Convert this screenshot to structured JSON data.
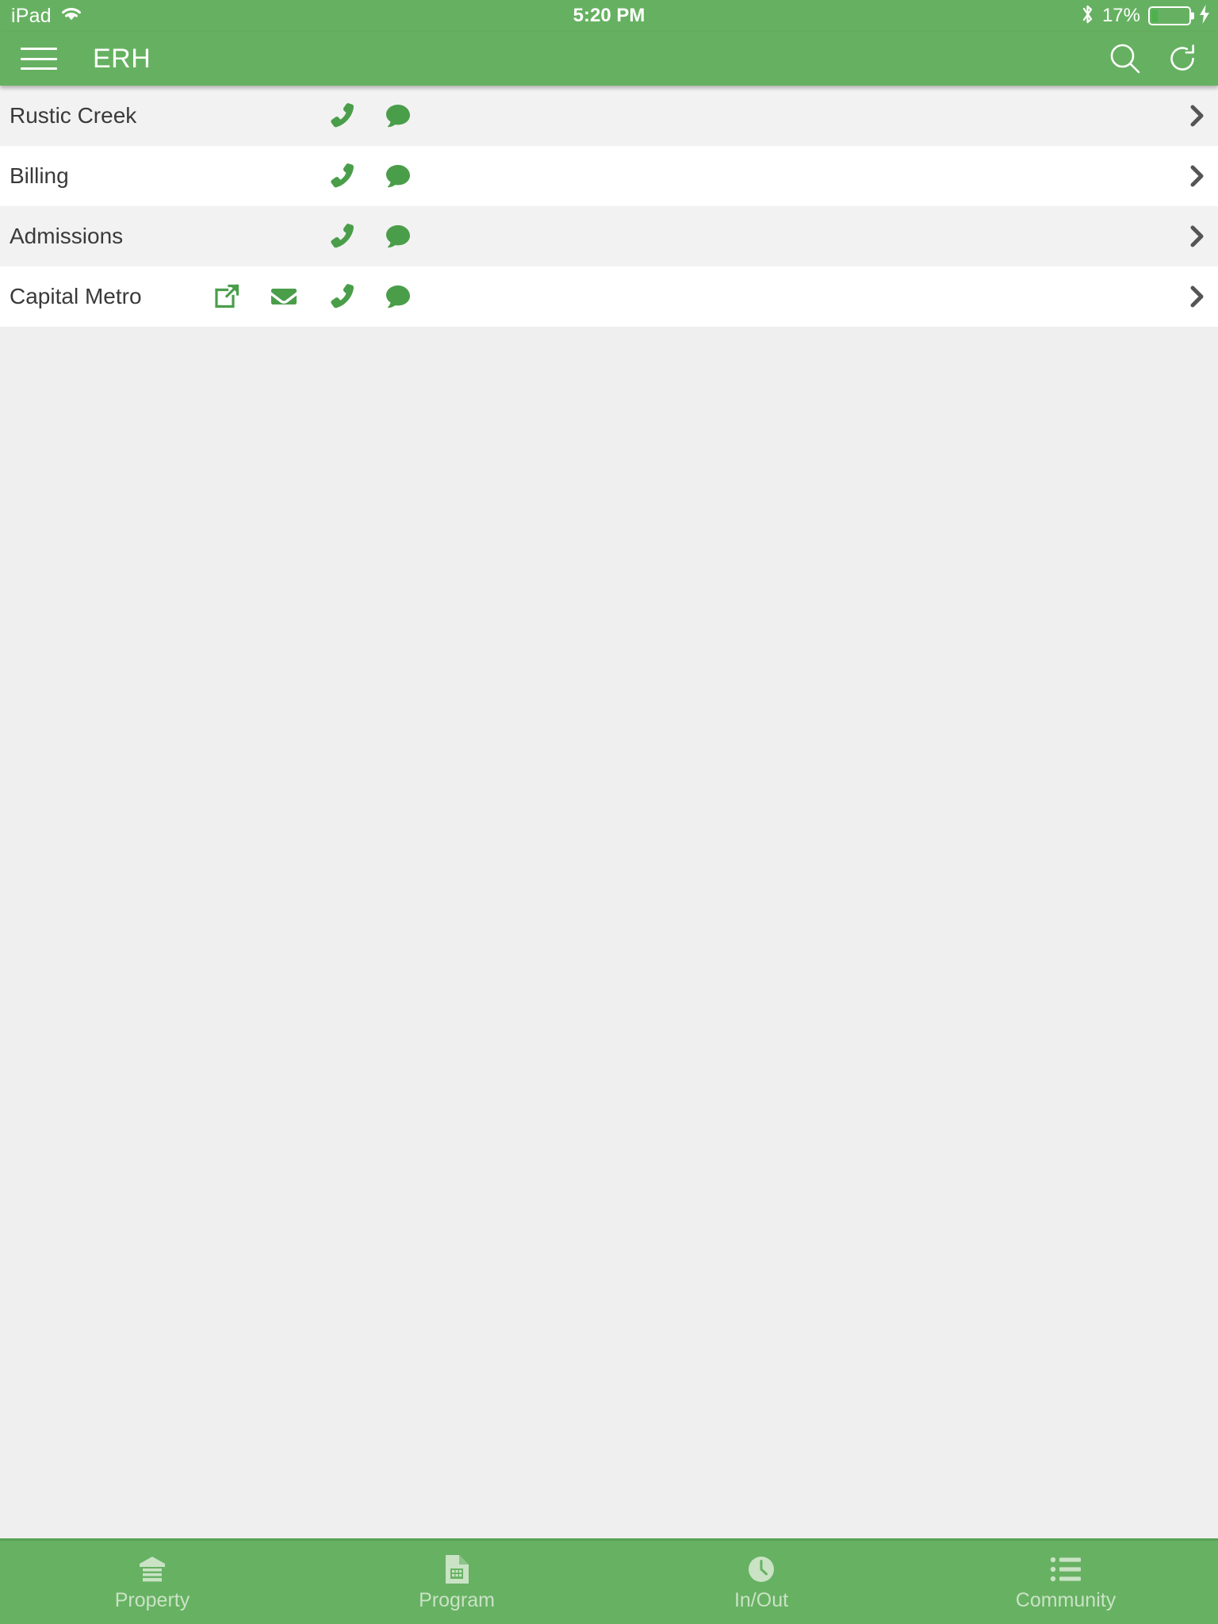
{
  "status_bar": {
    "carrier": "iPad",
    "wifi_icon": "wifi-icon",
    "time": "5:20 PM",
    "bluetooth_icon": "bluetooth-icon",
    "battery_percent": "17%",
    "battery_level": 17,
    "battery_icon": "battery-icon",
    "charging_icon": "lightning-bolt-icon"
  },
  "nav_bar": {
    "menu_icon": "hamburger-menu-icon",
    "title": "ERH",
    "search_icon": "search-icon",
    "refresh_icon": "refresh-icon"
  },
  "colors": {
    "brand_green": "#66b161",
    "tabbar_green": "#67b163",
    "icon_green": "#4a9e4a",
    "row_alt": "#f2f2f2",
    "row_base": "#ffffff",
    "body_bg": "#efefef",
    "chevron": "#555555",
    "tab_label": "#c9e3c4"
  },
  "list": {
    "rows": [
      {
        "label": "Rustic Creek",
        "icons": [
          "phone-icon",
          "comment-icon"
        ],
        "chevron": "chevron-right-icon"
      },
      {
        "label": "Billing",
        "icons": [
          "phone-icon",
          "comment-icon"
        ],
        "chevron": "chevron-right-icon"
      },
      {
        "label": "Admissions",
        "icons": [
          "phone-icon",
          "comment-icon"
        ],
        "chevron": "chevron-right-icon"
      },
      {
        "label": "Capital Metro",
        "icons": [
          "external-link-icon",
          "envelope-icon",
          "phone-icon",
          "comment-icon"
        ],
        "chevron": "chevron-right-icon"
      }
    ]
  },
  "tab_bar": {
    "tabs": [
      {
        "label": "Property",
        "icon": "building-icon"
      },
      {
        "label": "Program",
        "icon": "file-spreadsheet-icon"
      },
      {
        "label": "In/Out",
        "icon": "clock-icon"
      },
      {
        "label": "Community",
        "icon": "list-icon"
      }
    ]
  }
}
